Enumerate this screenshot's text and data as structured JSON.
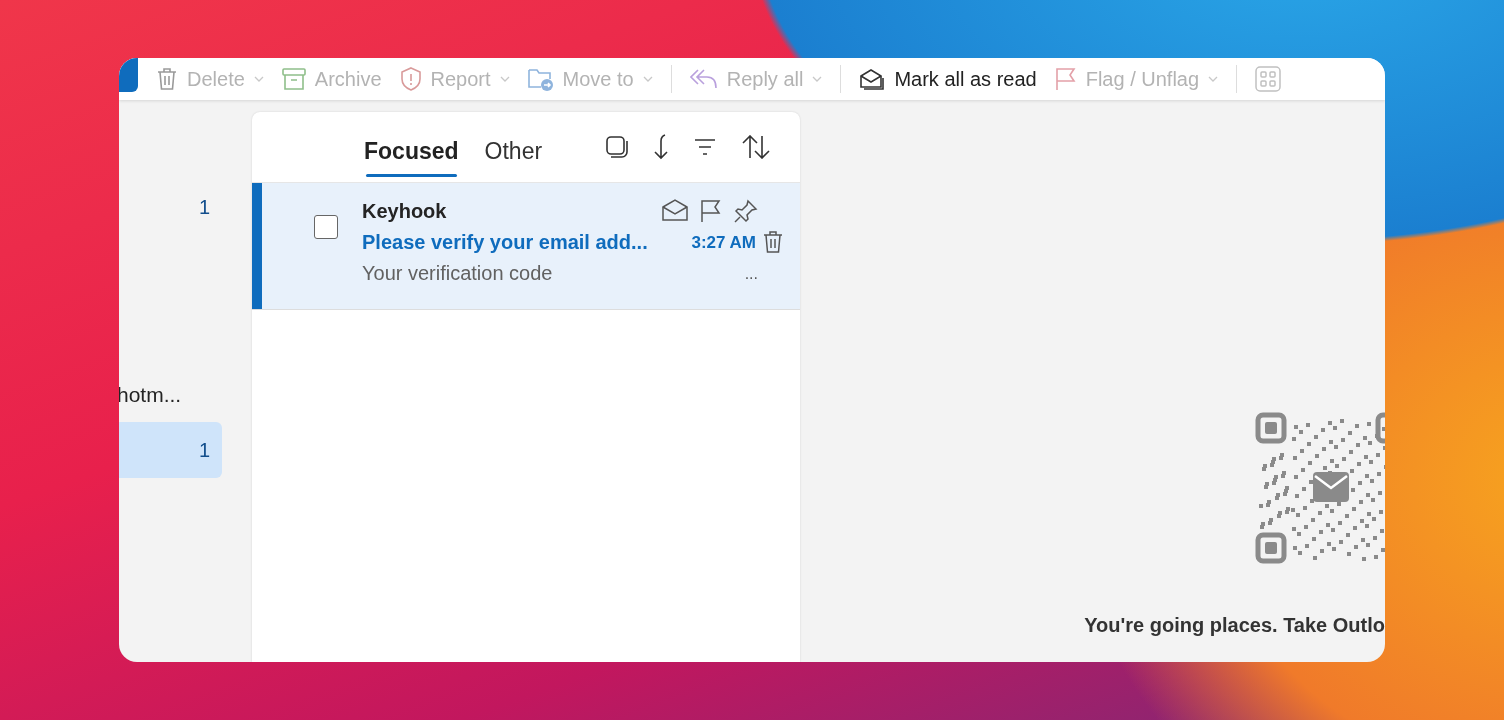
{
  "toolbar": {
    "items": [
      {
        "label": "Delete",
        "disabled": true,
        "dropdown": true
      },
      {
        "label": "Archive",
        "disabled": true,
        "dropdown": false
      },
      {
        "label": "Report",
        "disabled": true,
        "dropdown": true
      },
      {
        "label": "Move to",
        "disabled": true,
        "dropdown": true
      },
      {
        "label": "Reply all",
        "disabled": true,
        "dropdown": true
      },
      {
        "label": "Mark all as read",
        "disabled": false,
        "dropdown": false
      },
      {
        "label": "Flag / Unflag",
        "disabled": true,
        "dropdown": true
      }
    ]
  },
  "folder_pane": {
    "items": [
      {
        "kind": "folder",
        "count": "1",
        "selected": false
      },
      {
        "kind": "account",
        "label": "hotm..."
      },
      {
        "kind": "folder",
        "count": "1",
        "selected": true
      }
    ]
  },
  "message_list": {
    "tabs": [
      {
        "label": "Focused",
        "selected": true
      },
      {
        "label": "Other",
        "selected": false
      }
    ],
    "messages": [
      {
        "sender": "Keyhook",
        "subject": "Please verify your email add...",
        "time": "3:27 AM",
        "preview": "Your verification code",
        "more": "...",
        "selected": true,
        "unread": true,
        "checked": false
      }
    ]
  },
  "reading_pane": {
    "message": "You're going places. Take Outlo"
  }
}
